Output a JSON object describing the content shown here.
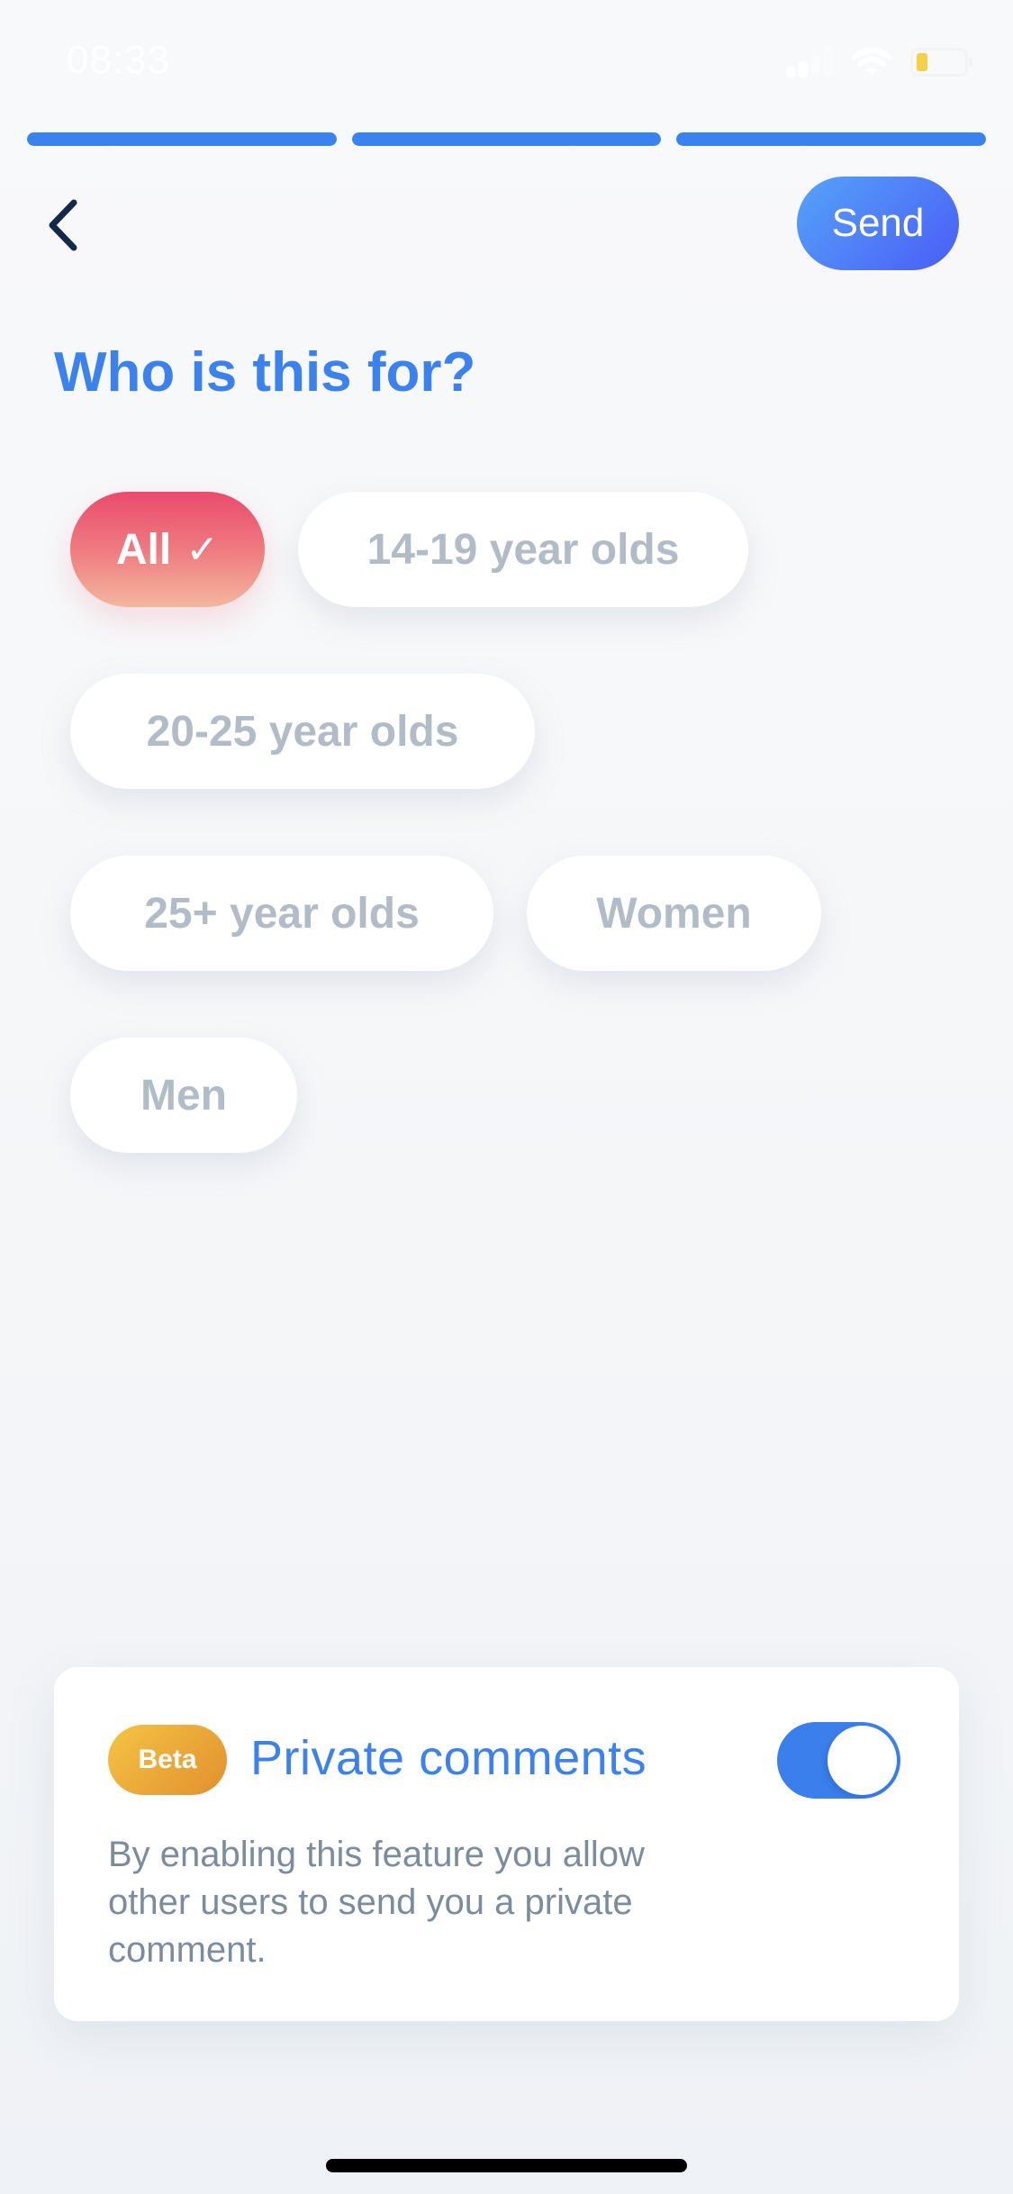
{
  "status_bar": {
    "time": "08:33",
    "icons": [
      "signal-icon",
      "wifi-icon",
      "battery-low-icon"
    ]
  },
  "progress": {
    "steps_total": 3,
    "steps": [
      {
        "fill": 1.0
      },
      {
        "fill": 1.0
      },
      {
        "fill": 1.0
      }
    ],
    "color": "#3A82F0"
  },
  "nav": {
    "back_icon": "chevron-left-icon",
    "send_label": "Send"
  },
  "page": {
    "title": "Who is this for?"
  },
  "audience": {
    "chips": [
      {
        "label": "All",
        "selected": true,
        "check": "✓"
      },
      {
        "label": "14-19 year olds",
        "selected": false
      },
      {
        "label": "20-25 year olds",
        "selected": false
      },
      {
        "label": "25+ year olds",
        "selected": false
      },
      {
        "label": "Women",
        "selected": false
      },
      {
        "label": "Men",
        "selected": false
      }
    ]
  },
  "private_comments": {
    "badge": "Beta",
    "title": "Private comments",
    "enabled": true,
    "description": "By enabling this feature you allow other users to send you a private comment."
  },
  "colors": {
    "accent": "#3B82EE",
    "selected_chip_top": "#EA4B6C",
    "selected_chip_bottom": "#F4B69D",
    "beta_badge": "#E9A536",
    "chip_text": "#B2BCC7",
    "description_text": "#7A8C9E"
  }
}
